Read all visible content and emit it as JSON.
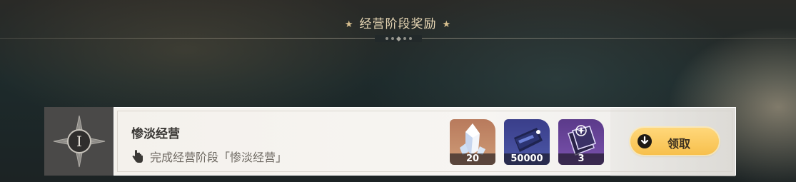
{
  "header": {
    "title": "经营阶段奖励"
  },
  "stage": {
    "badge_numeral": "I",
    "title": "惨淡经营",
    "description": "完成经营阶段「惨淡经营」"
  },
  "rewards": [
    {
      "icon": "crystal-icon",
      "count": "20"
    },
    {
      "icon": "ticket-icon",
      "count": "50000"
    },
    {
      "icon": "card-pack-icon",
      "count": "3"
    }
  ],
  "claim_button": {
    "label": "领取"
  },
  "colors": {
    "accent": "#f7c04d",
    "title_gold": "#e8d7b5"
  }
}
